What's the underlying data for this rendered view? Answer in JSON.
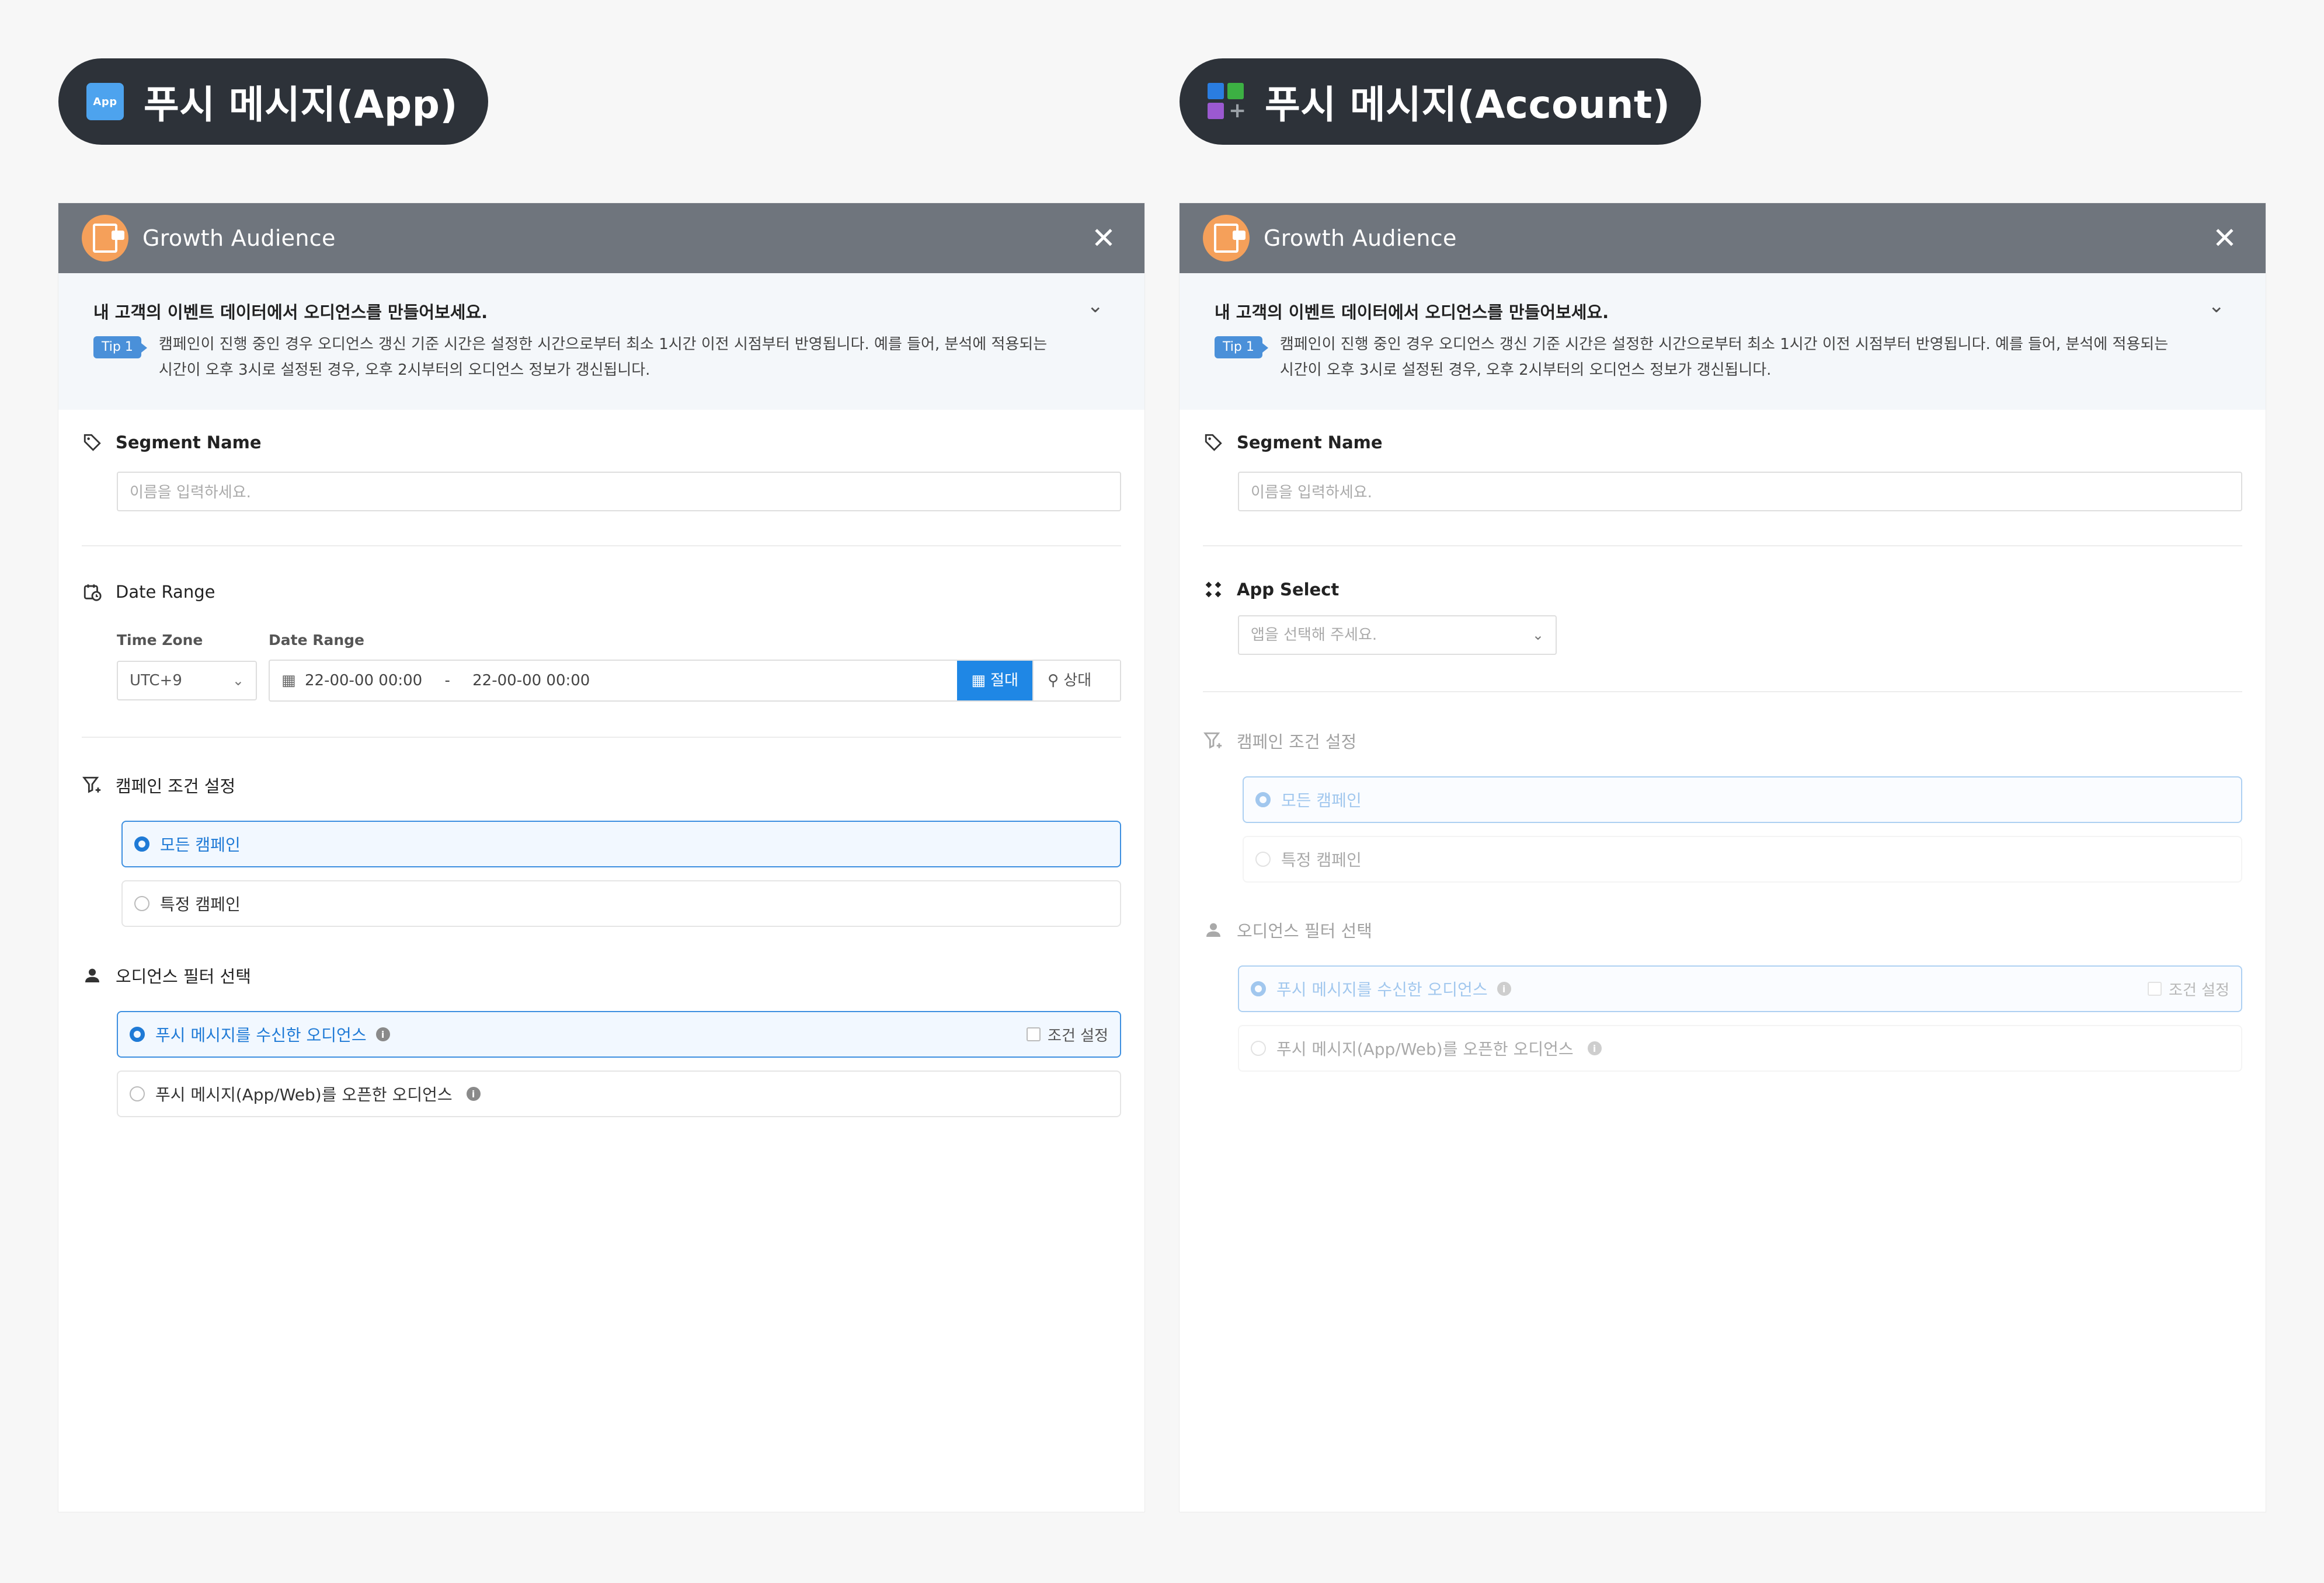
{
  "left": {
    "pill": {
      "badge": "App",
      "title": "푸시 메시지(App)"
    },
    "header": {
      "title": "Growth Audience",
      "close": "✕"
    },
    "intro": {
      "title": "내 고객의 이벤트 데이터에서 오디언스를 만들어보세요.",
      "tip_badge": "Tip 1",
      "tip_line1": "캠페인이 진행 중인 경우 오디언스 갱신 기준 시간은 설정한 시간으로부터 최소 1시간 이전 시점부터 반영됩니다. 예를 들어, 분석에 적용되는",
      "tip_line2": "시간이 오후 3시로 설정된 경우, 오후 2시부터의 오디언스 정보가 갱신됩니다."
    },
    "segment": {
      "label": "Segment Name",
      "placeholder": "이름을 입력하세요."
    },
    "date": {
      "label": "Date Range",
      "tz_label": "Time Zone",
      "tz_value": "UTC+9",
      "range_label": "Date Range",
      "start": "22-00-00 00:00",
      "sep": "-",
      "end": "22-00-00 00:00",
      "abs": "절대",
      "rel": "상대"
    },
    "campaign": {
      "label": "캠페인 조건 설정",
      "all": "모든 캠페인",
      "specific": "특정 캠페인"
    },
    "audience": {
      "label": "오디언스 필터 선택",
      "received": "푸시 메시지를 수신한 오디언스",
      "condition": "조건 설정",
      "opened": "푸시 메시지(App/Web)를 오픈한 오디언스"
    }
  },
  "right": {
    "pill": {
      "title": "푸시 메시지(Account)"
    },
    "header": {
      "title": "Growth Audience",
      "close": "✕"
    },
    "intro": {
      "title": "내 고객의 이벤트 데이터에서 오디언스를 만들어보세요.",
      "tip_badge": "Tip 1",
      "tip_line1": "캠페인이 진행 중인 경우 오디언스 갱신 기준 시간은 설정한 시간으로부터 최소 1시간 이전 시점부터 반영됩니다. 예를 들어, 분석에 적용되는",
      "tip_line2": "시간이 오후 3시로 설정된 경우, 오후 2시부터의 오디언스 정보가 갱신됩니다."
    },
    "segment": {
      "label": "Segment Name",
      "placeholder": "이름을 입력하세요."
    },
    "app_select": {
      "label": "App Select",
      "placeholder": "앱을 선택해 주세요."
    },
    "campaign": {
      "label": "캠페인 조건 설정",
      "all": "모든 캠페인",
      "specific": "특정 캠페인"
    },
    "audience": {
      "label": "오디언스 필터 선택",
      "received": "푸시 메시지를 수신한 오디언스",
      "condition": "조건 설정",
      "opened": "푸시 메시지(App/Web)를 오픈한 오디언스"
    }
  },
  "colors": {
    "accent": "#1f87e5",
    "header_bg": "#6f757d",
    "pill_bg": "#2d3239",
    "brand_orange": "#f5a05a"
  }
}
